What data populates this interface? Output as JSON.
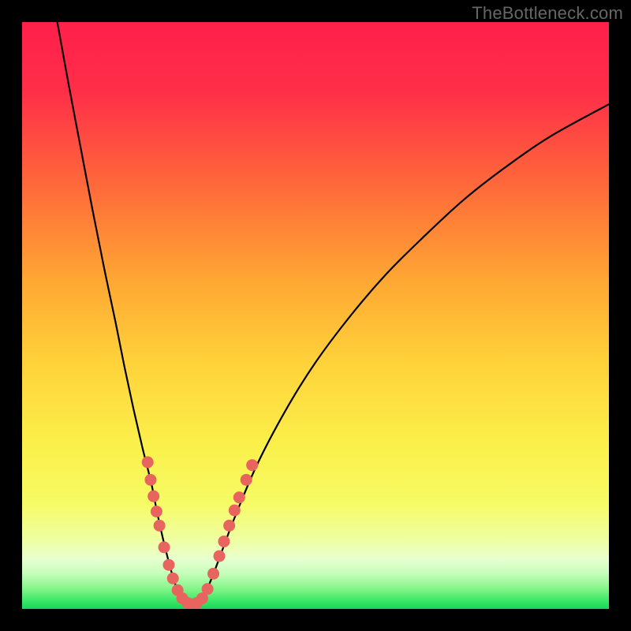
{
  "watermark": "TheBottleneck.com",
  "chart_data": {
    "type": "line",
    "title": "",
    "xlabel": "",
    "ylabel": "",
    "xlim": [
      0,
      100
    ],
    "ylim": [
      0,
      100
    ],
    "gradient_stops": [
      {
        "offset": 0.0,
        "color": "#ff1f4b"
      },
      {
        "offset": 0.12,
        "color": "#ff2f48"
      },
      {
        "offset": 0.28,
        "color": "#ff6a3a"
      },
      {
        "offset": 0.44,
        "color": "#ffa733"
      },
      {
        "offset": 0.58,
        "color": "#ffd23a"
      },
      {
        "offset": 0.72,
        "color": "#fbf04a"
      },
      {
        "offset": 0.82,
        "color": "#f6fb65"
      },
      {
        "offset": 0.885,
        "color": "#eeffa5"
      },
      {
        "offset": 0.915,
        "color": "#e8ffd0"
      },
      {
        "offset": 0.94,
        "color": "#c4ffba"
      },
      {
        "offset": 0.965,
        "color": "#86f58a"
      },
      {
        "offset": 0.985,
        "color": "#3fe868"
      },
      {
        "offset": 1.0,
        "color": "#17d65a"
      }
    ],
    "series": [
      {
        "name": "left-arm",
        "x": [
          6.0,
          8.0,
          10.0,
          12.0,
          14.0,
          16.0,
          17.5,
          19.0,
          20.5,
          22.0,
          23.0,
          24.0,
          25.0,
          26.0,
          27.0
        ],
        "values": [
          100.0,
          89.0,
          78.5,
          68.0,
          58.0,
          48.5,
          41.0,
          34.0,
          27.5,
          21.5,
          16.5,
          12.0,
          8.0,
          4.5,
          2.0
        ]
      },
      {
        "name": "valley-floor",
        "x": [
          27.0,
          28.0,
          29.0,
          30.0,
          31.0
        ],
        "values": [
          2.0,
          1.0,
          0.7,
          1.0,
          2.0
        ]
      },
      {
        "name": "right-arm",
        "x": [
          31.0,
          33.0,
          36.0,
          40.0,
          45.0,
          50.0,
          56.0,
          62.0,
          68.0,
          75.0,
          82.0,
          90.0,
          100.0
        ],
        "values": [
          2.0,
          7.0,
          15.0,
          24.5,
          34.0,
          42.0,
          50.0,
          57.0,
          63.0,
          69.5,
          75.0,
          80.5,
          86.0
        ]
      }
    ],
    "markers": {
      "name": "highlighted-points",
      "color": "#e8645f",
      "points_xy": [
        [
          21.4,
          25.0
        ],
        [
          21.9,
          22.0
        ],
        [
          22.4,
          19.2
        ],
        [
          22.9,
          16.6
        ],
        [
          23.4,
          14.2
        ],
        [
          24.2,
          10.5
        ],
        [
          25.0,
          7.5
        ],
        [
          25.7,
          5.2
        ],
        [
          26.5,
          3.2
        ],
        [
          27.3,
          1.8
        ],
        [
          28.2,
          1.0
        ],
        [
          29.0,
          0.8
        ],
        [
          29.8,
          1.0
        ],
        [
          30.7,
          1.8
        ],
        [
          31.6,
          3.4
        ],
        [
          32.6,
          6.0
        ],
        [
          33.6,
          9.0
        ],
        [
          34.4,
          11.5
        ],
        [
          35.3,
          14.2
        ],
        [
          36.2,
          16.8
        ],
        [
          37.0,
          19.0
        ],
        [
          38.2,
          22.0
        ],
        [
          39.2,
          24.5
        ]
      ]
    }
  }
}
